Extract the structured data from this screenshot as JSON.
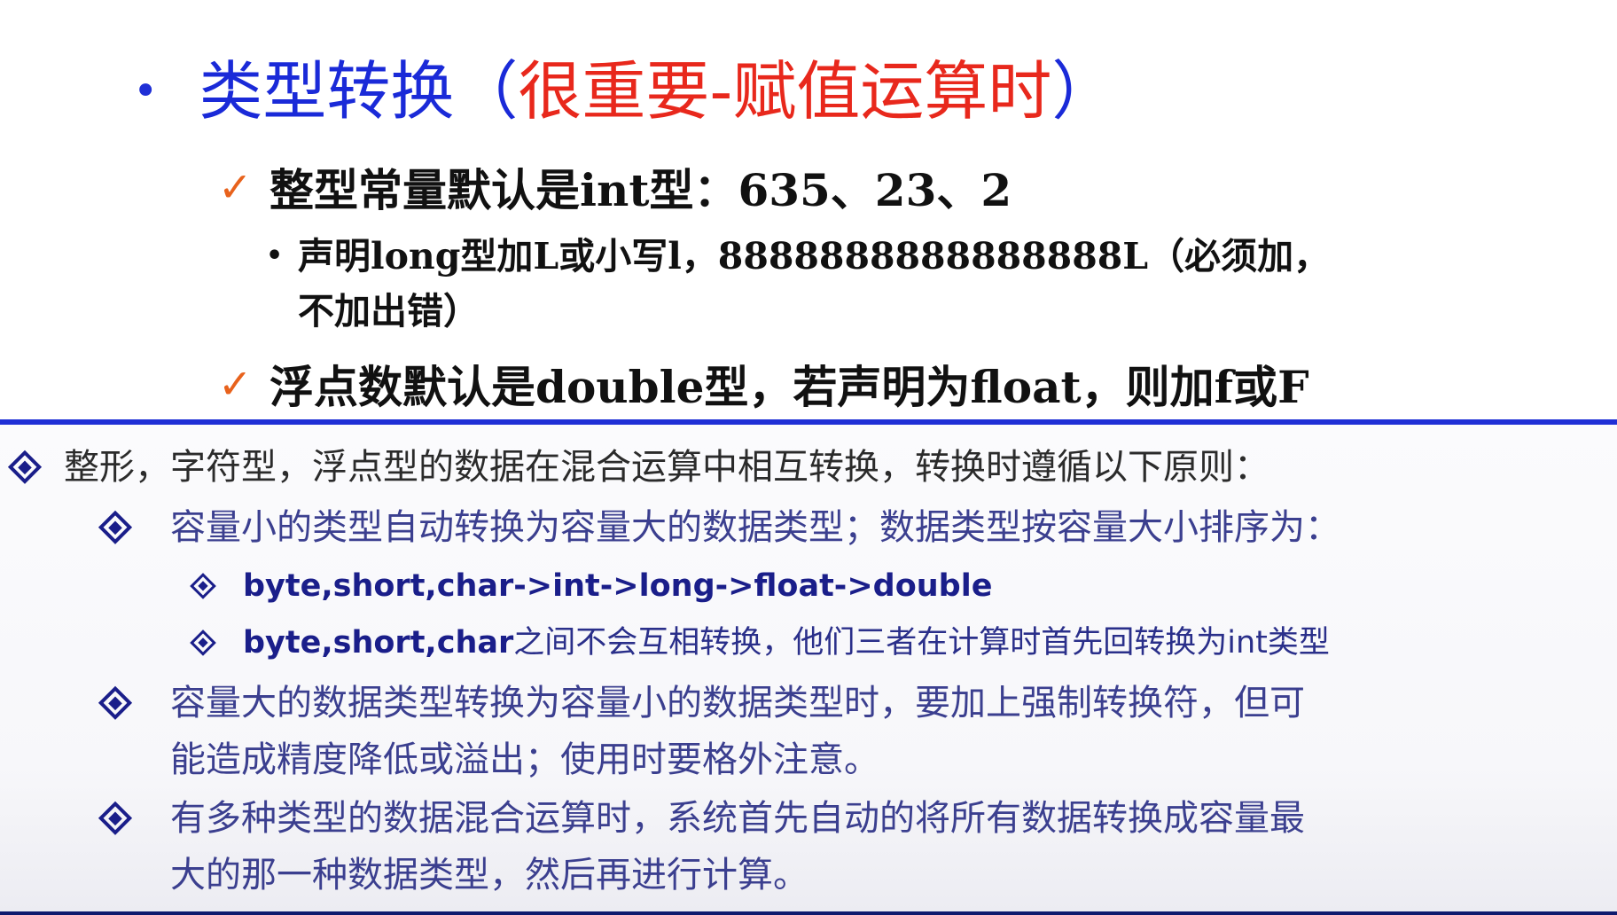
{
  "slide": {
    "title_bullet": "•",
    "title_main": "类型转换",
    "title_paren_open": "（",
    "title_emphasis": "很重要-赋值运算时",
    "title_paren_close": "）",
    "point1": "整型常量默认是int型：635、23、2",
    "point1_sub_line1": "声明long型加L或小写l，8888888888888888L（必须加，",
    "point1_sub_line2": "不加出错）",
    "point2": "浮点数默认是double型，若声明为float，则加f或F",
    "check_icon": "✓",
    "sub_bullet": "•"
  },
  "lecture": {
    "rule_intro": "整形，字符型，浮点型的数据在混合运算中相互转换，转换时遵循以下原则：",
    "rule1": "容量小的类型自动转换为容量大的数据类型；数据类型按容量大小排序为：",
    "rule1_order": "byte,short,char->int->long->float->double",
    "rule1_note_code": "byte,short,char",
    "rule1_note_text": "之间不会互相转换，他们三者在计算时首先回转换为int类型",
    "rule2_line1": "容量大的数据类型转换为容量小的数据类型时，要加上强制转换符，但可",
    "rule2_line2": "能造成精度降低或溢出；使用时要格外注意。",
    "rule3_line1": "有多种类型的数据混合运算时，系统首先自动的将所有数据转换成容量最",
    "rule3_line2": "大的那一种数据类型，然后再进行计算。"
  },
  "colors": {
    "title_blue": "#1a2ad8",
    "title_red": "#e8281c",
    "check_orange": "#e8621c",
    "divider_blue": "#1f2fd6",
    "lecture_navy": "#1a1e8a"
  },
  "icons": {
    "check": "check-mark-icon",
    "bullet_diamond": "diamond-bullet-icon"
  }
}
